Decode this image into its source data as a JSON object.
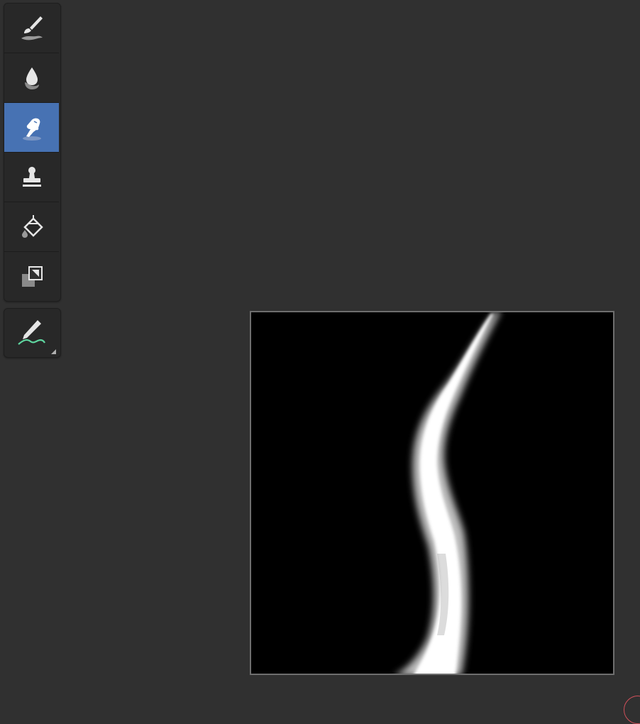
{
  "tools": [
    {
      "id": "draw",
      "icon": "brush-icon",
      "active": false
    },
    {
      "id": "soften",
      "icon": "soften-drop-icon",
      "active": false
    },
    {
      "id": "smear",
      "icon": "smear-finger-icon",
      "active": true
    },
    {
      "id": "clone",
      "icon": "clone-stamp-icon",
      "active": false
    },
    {
      "id": "fill",
      "icon": "fill-bucket-icon",
      "active": false
    },
    {
      "id": "mask",
      "icon": "mask-layers-icon",
      "active": false
    }
  ],
  "annotate_tool": {
    "id": "annotate",
    "icon": "annotate-pencil-icon"
  },
  "colors": {
    "background": "#303030",
    "toolbar": "#282828",
    "active_tool": "#4772b3",
    "canvas": "#000000",
    "stroke": "#ffffff",
    "annotate_curve": "#5fd6a0",
    "cursor_ring": "#d0505a"
  }
}
